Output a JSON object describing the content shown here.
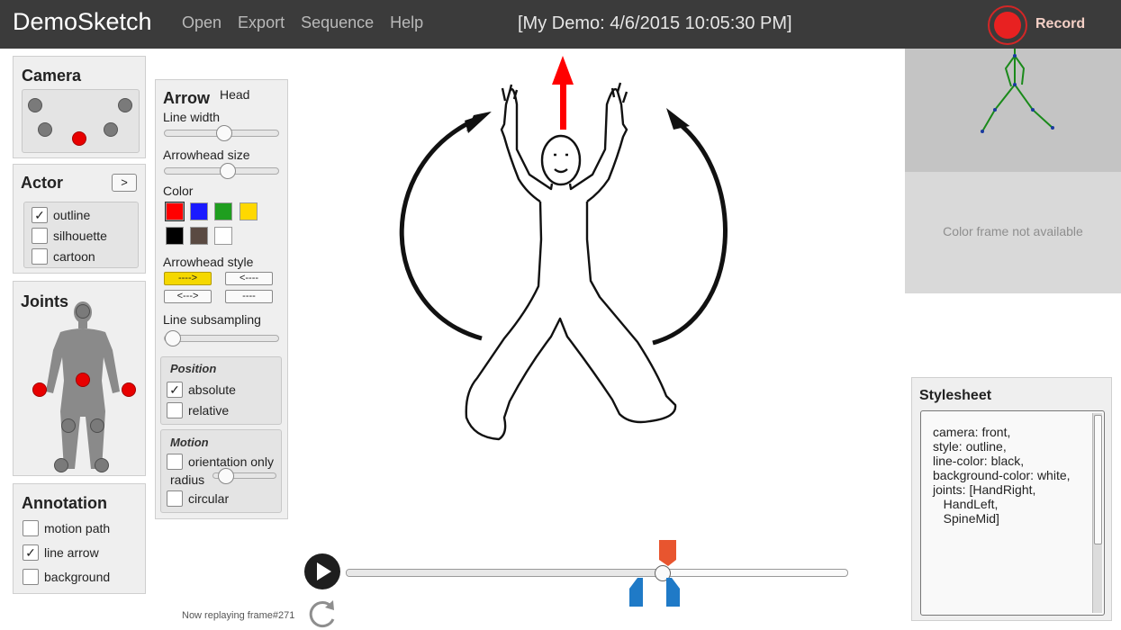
{
  "app": {
    "title": "DemoSketch"
  },
  "menu": {
    "items": [
      {
        "label": "Open"
      },
      {
        "label": "Export"
      },
      {
        "label": "Sequence"
      },
      {
        "label": "Help"
      }
    ]
  },
  "session": {
    "title": "[My Demo: 4/6/2015 10:05:30 PM]"
  },
  "record": {
    "label": "Record"
  },
  "camera": {
    "title": "Camera"
  },
  "actor": {
    "title": "Actor",
    "expand_label": ">",
    "options": [
      {
        "label": "outline",
        "checked": true
      },
      {
        "label": "silhouette",
        "checked": false
      },
      {
        "label": "cartoon",
        "checked": false
      }
    ]
  },
  "joints": {
    "title": "Joints"
  },
  "annotation": {
    "title": "Annotation",
    "options": [
      {
        "label": "motion path",
        "checked": false
      },
      {
        "label": "line arrow",
        "checked": true
      },
      {
        "label": "background",
        "checked": false
      }
    ]
  },
  "arrow": {
    "title": "Arrow",
    "target": "Head",
    "line_width_label": "Line width",
    "line_width_value": 0.52,
    "arrowhead_size_label": "Arrowhead size",
    "arrowhead_size_value": 0.55,
    "color_label": "Color",
    "colors": [
      "#ff0000",
      "#1a1aff",
      "#1f9e1f",
      "#ffd800",
      "#000000",
      "#5a4a42",
      "#ffffff"
    ],
    "selected_color": "#ff0000",
    "arrowhead_style_label": "Arrowhead style",
    "arrowhead_styles": [
      {
        "label": "---->",
        "active": true
      },
      {
        "label": "<----",
        "active": false
      },
      {
        "label": "<--->",
        "active": false
      },
      {
        "label": "----",
        "active": false
      }
    ],
    "line_subsampling_label": "Line subsampling",
    "line_subsampling_value": 0.0,
    "position": {
      "title": "Position",
      "options": [
        {
          "label": "absolute",
          "checked": true
        },
        {
          "label": "relative",
          "checked": false
        }
      ]
    },
    "motion": {
      "title": "Motion",
      "orientation_label": "orientation only",
      "orientation_checked": false,
      "radius_label": "radius",
      "radius_value": 0.1,
      "circular_label": "circular",
      "circular_checked": false
    }
  },
  "preview": {
    "color_frame_message": "Color frame not available"
  },
  "stylesheet": {
    "title": "Stylesheet",
    "lines": [
      "camera: front,",
      "style: outline,",
      "line-color: black,",
      "background-color: white,",
      "joints: [HandRight,",
      "   HandLeft,",
      "   SpineMid]"
    ]
  },
  "playback": {
    "status": "Now replaying frame#271",
    "position": 0.63
  },
  "colors": {
    "topbar": "#3b3b3b",
    "record": "#e82121",
    "highlight": "#f5d800",
    "marker_top": "#e8552f",
    "marker_bottom": "#1f7ac7"
  }
}
